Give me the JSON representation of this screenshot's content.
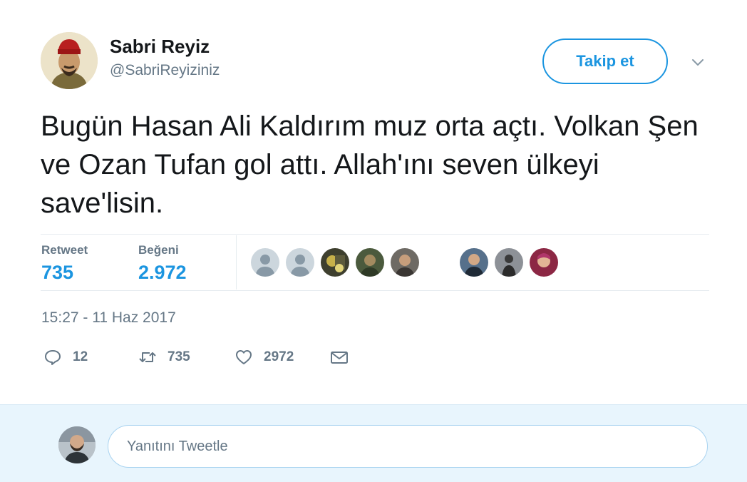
{
  "tweet": {
    "author_name": "Sabri Reyiz",
    "author_handle": "@SabriReyiziniz",
    "follow_label": "Takip et",
    "text": "Bugün Hasan Ali Kaldırım muz orta açtı. Volkan Şen ve Ozan Tufan gol attı. Allah'ını seven ülkeyi save'lisin.",
    "stats": {
      "retweet_label": "Retweet",
      "retweet_value": "735",
      "like_label": "Beğeni",
      "like_value": "2.972"
    },
    "timestamp": "15:27 - 11 Haz 2017",
    "actions": {
      "reply_count": "12",
      "retweet_count": "735",
      "like_count": "2972"
    }
  },
  "reply": {
    "placeholder": "Yanıtını Tweetle"
  },
  "colors": {
    "accent": "#1b95e0",
    "muted_text": "#657786",
    "reply_bar_bg": "#e8f5fd"
  },
  "icons": [
    "chevron-down-icon",
    "reply-icon",
    "retweet-icon",
    "heart-icon",
    "mail-icon"
  ]
}
